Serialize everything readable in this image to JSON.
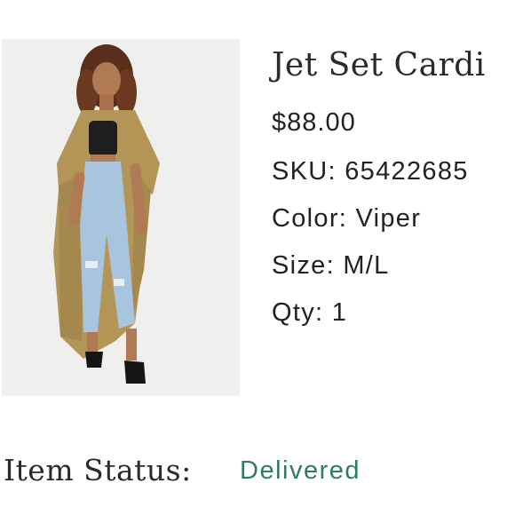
{
  "product": {
    "name": "Jet Set Cardi",
    "price": "$88.00",
    "sku": "SKU: 65422685",
    "color": "Color: Viper",
    "size": "Size: M/L",
    "qty": "Qty: 1",
    "image_icon": "product-photo"
  },
  "status": {
    "label": "Item Status:",
    "value": "Delivered",
    "value_color": "#2e7d5b"
  }
}
